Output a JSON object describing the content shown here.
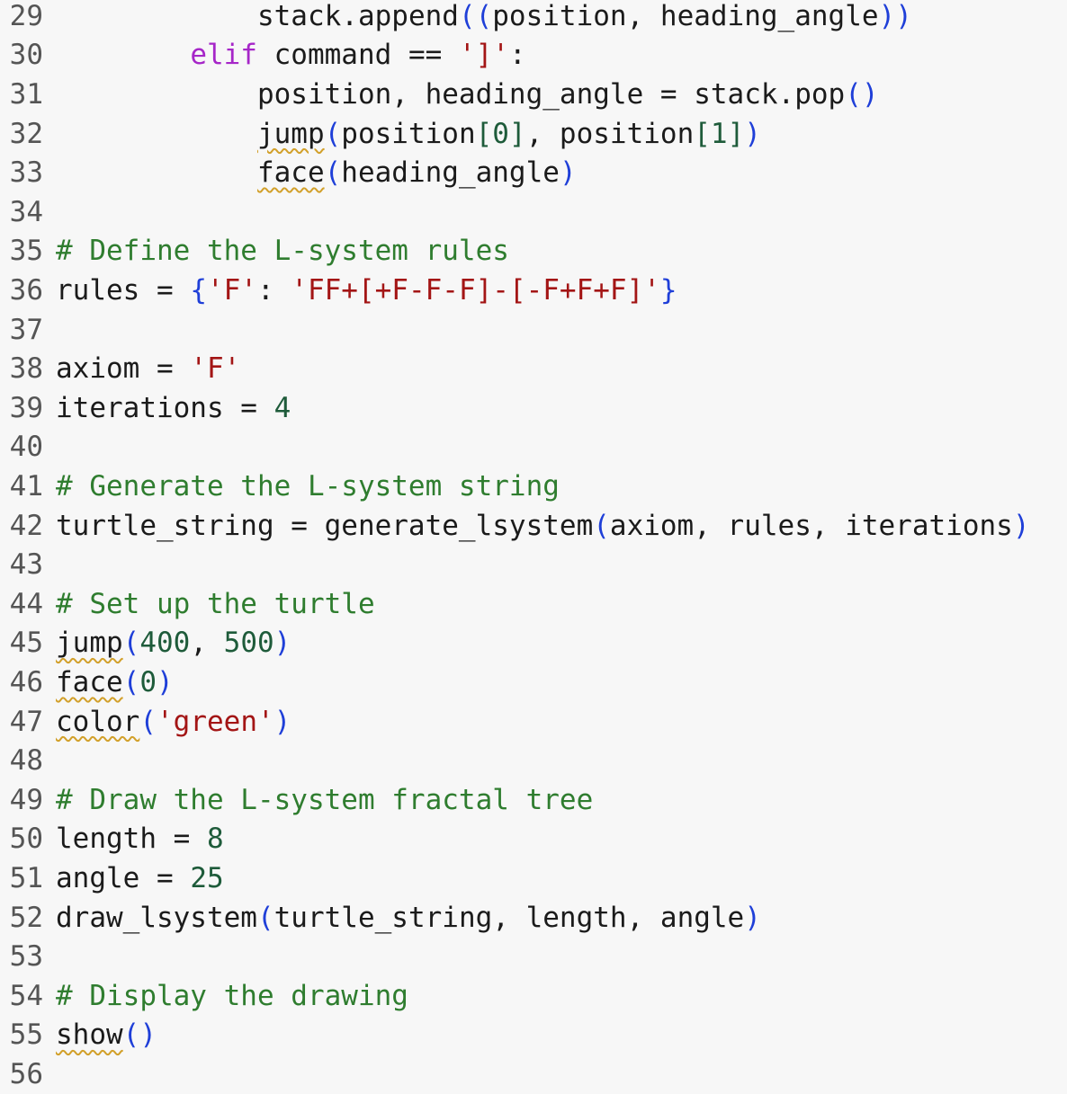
{
  "editor": {
    "lines": [
      {
        "no": "29",
        "indent": "            ",
        "tokens": [
          [
            "t",
            "stack.append"
          ],
          [
            "p",
            "(("
          ],
          [
            "t",
            "position, heading_angle"
          ],
          [
            "p",
            "))"
          ]
        ]
      },
      {
        "no": "30",
        "indent": "        ",
        "tokens": [
          [
            "k",
            "elif"
          ],
          [
            "t",
            " command == "
          ],
          [
            "s",
            "']'"
          ],
          [
            "t",
            ":"
          ]
        ]
      },
      {
        "no": "31",
        "indent": "            ",
        "tokens": [
          [
            "t",
            "position, heading_angle = stack.pop"
          ],
          [
            "p",
            "()"
          ]
        ]
      },
      {
        "no": "32",
        "indent": "            ",
        "tokens": [
          [
            "w",
            "jump"
          ],
          [
            "p",
            "("
          ],
          [
            "t",
            "position"
          ],
          [
            "n",
            "[0]"
          ],
          [
            "t",
            ", position"
          ],
          [
            "n",
            "[1]"
          ],
          [
            "p",
            ")"
          ]
        ]
      },
      {
        "no": "33",
        "indent": "            ",
        "tokens": [
          [
            "w",
            "face"
          ],
          [
            "p",
            "("
          ],
          [
            "t",
            "heading_angle"
          ],
          [
            "p",
            ")"
          ]
        ]
      },
      {
        "no": "34",
        "indent": "",
        "tokens": []
      },
      {
        "no": "35",
        "indent": "",
        "tokens": [
          [
            "c",
            "# Define the L-system rules"
          ]
        ]
      },
      {
        "no": "36",
        "indent": "",
        "tokens": [
          [
            "t",
            "rules = "
          ],
          [
            "p",
            "{"
          ],
          [
            "s",
            "'F'"
          ],
          [
            "t",
            ": "
          ],
          [
            "s",
            "'FF+[+F-F-F]-[-F+F+F]'"
          ],
          [
            "p",
            "}"
          ]
        ]
      },
      {
        "no": "37",
        "indent": "",
        "tokens": []
      },
      {
        "no": "38",
        "indent": "",
        "tokens": [
          [
            "t",
            "axiom = "
          ],
          [
            "s",
            "'F'"
          ]
        ]
      },
      {
        "no": "39",
        "indent": "",
        "tokens": [
          [
            "t",
            "iterations = "
          ],
          [
            "n",
            "4"
          ]
        ]
      },
      {
        "no": "40",
        "indent": "",
        "tokens": []
      },
      {
        "no": "41",
        "indent": "",
        "tokens": [
          [
            "c",
            "# Generate the L-system string"
          ]
        ]
      },
      {
        "no": "42",
        "indent": "",
        "tokens": [
          [
            "t",
            "turtle_string = generate_lsystem"
          ],
          [
            "p",
            "("
          ],
          [
            "t",
            "axiom, rules, iterations"
          ],
          [
            "p",
            ")"
          ]
        ]
      },
      {
        "no": "43",
        "indent": "",
        "tokens": []
      },
      {
        "no": "44",
        "indent": "",
        "tokens": [
          [
            "c",
            "# Set up the turtle"
          ]
        ]
      },
      {
        "no": "45",
        "indent": "",
        "tokens": [
          [
            "w",
            "jump"
          ],
          [
            "p",
            "("
          ],
          [
            "n",
            "400"
          ],
          [
            "t",
            ", "
          ],
          [
            "n",
            "500"
          ],
          [
            "p",
            ")"
          ]
        ]
      },
      {
        "no": "46",
        "indent": "",
        "tokens": [
          [
            "w",
            "face"
          ],
          [
            "p",
            "("
          ],
          [
            "n",
            "0"
          ],
          [
            "p",
            ")"
          ]
        ]
      },
      {
        "no": "47",
        "indent": "",
        "tokens": [
          [
            "w",
            "color"
          ],
          [
            "p",
            "("
          ],
          [
            "s",
            "'green'"
          ],
          [
            "p",
            ")"
          ]
        ]
      },
      {
        "no": "48",
        "indent": "",
        "tokens": []
      },
      {
        "no": "49",
        "indent": "",
        "tokens": [
          [
            "c",
            "# Draw the L-system fractal tree"
          ]
        ]
      },
      {
        "no": "50",
        "indent": "",
        "tokens": [
          [
            "t",
            "length = "
          ],
          [
            "n",
            "8"
          ]
        ]
      },
      {
        "no": "51",
        "indent": "",
        "tokens": [
          [
            "t",
            "angle = "
          ],
          [
            "n",
            "25"
          ]
        ]
      },
      {
        "no": "52",
        "indent": "",
        "tokens": [
          [
            "t",
            "draw_lsystem"
          ],
          [
            "p",
            "("
          ],
          [
            "t",
            "turtle_string, length, angle"
          ],
          [
            "p",
            ")"
          ]
        ]
      },
      {
        "no": "53",
        "indent": "",
        "tokens": []
      },
      {
        "no": "54",
        "indent": "",
        "tokens": [
          [
            "c",
            "# Display the drawing"
          ]
        ]
      },
      {
        "no": "55",
        "indent": "",
        "tokens": [
          [
            "w",
            "show"
          ],
          [
            "p",
            "()"
          ]
        ]
      },
      {
        "no": "56",
        "indent": "",
        "tokens": []
      }
    ]
  },
  "colors": {
    "background": "#f7f7f7",
    "line_number": "#555555",
    "text": "#1b1b1b",
    "keyword": "#a626c8",
    "comment": "#2f7d2f",
    "string": "#a31515",
    "number": "#1e5b3a",
    "bracket": "#1f3fd8",
    "squiggle": "#d2a02a"
  }
}
